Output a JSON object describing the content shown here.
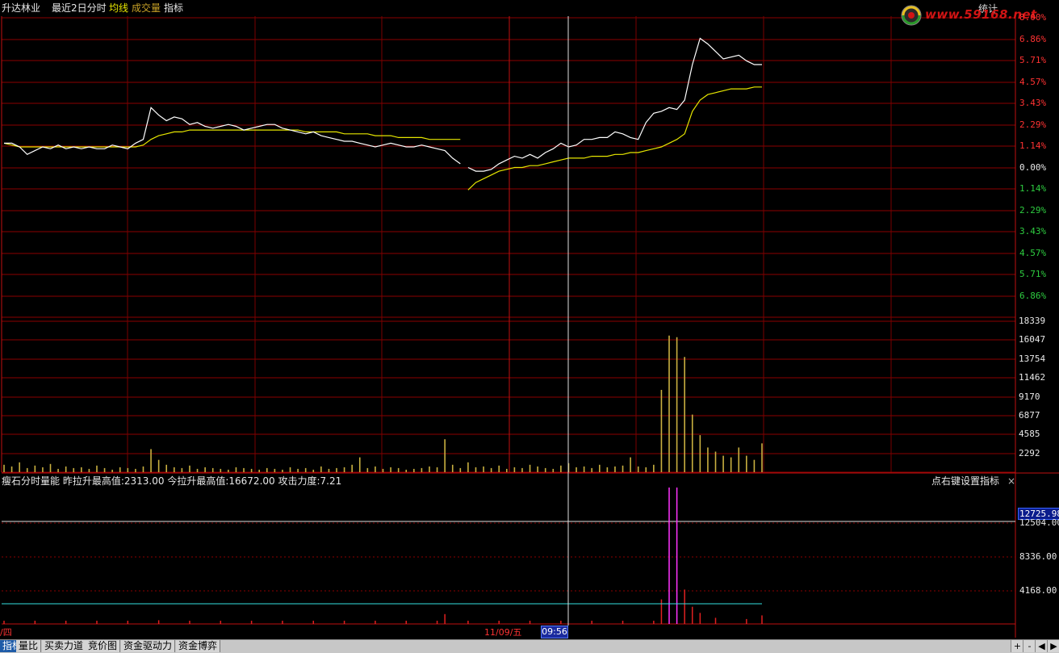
{
  "header": {
    "stock_name": "升达林业",
    "period": "最近2日分时",
    "avg_line_label": "均线",
    "volume_label": "成交量",
    "indicator_label": "指标",
    "stats_button": "统计",
    "watermark": "www.59168.net"
  },
  "price_axis": {
    "up_labels": [
      "8.00%",
      "6.86%",
      "5.71%",
      "4.57%",
      "3.43%",
      "2.29%",
      "1.14%"
    ],
    "zero_label": "0.00%",
    "down_labels": [
      "1.14%",
      "2.29%",
      "3.43%",
      "4.57%",
      "5.71%",
      "6.86%"
    ]
  },
  "volume_axis": [
    "18339",
    "16047",
    "13754",
    "11462",
    "9170",
    "6877",
    "4585",
    "2292"
  ],
  "indicator": {
    "title": "瘦石分时量能",
    "yesterday_label": "昨拉升最高值:",
    "yesterday_value": "2313.00",
    "today_label": "今拉升最高值:",
    "today_value": "16672.00",
    "attack_label": "攻击力度:",
    "attack_value": "7.21",
    "hint": "点右键设置指标",
    "close_symbol": "×",
    "levels": [
      "12725.98",
      "12504.00",
      "8336.00",
      "4168.00"
    ]
  },
  "time_axis": {
    "day1_label": "/四",
    "day2_label": "11/09/五",
    "cursor_time": "09:56"
  },
  "tabs": [
    "指标",
    "量比",
    "买卖力道",
    "竞价图",
    "资金驱动力",
    "资金博弈"
  ],
  "tab_buttons": [
    "+",
    "-",
    "◀",
    "▶"
  ],
  "colors": {
    "grid": "#8c0000",
    "price": "#ffffff",
    "avg": "#e6e600",
    "volume": "#c9b040",
    "magenta": "#ff33ff",
    "cyan": "#33e0e0"
  },
  "chart_data": {
    "type": "line",
    "title": "",
    "ylim": [
      -8.0,
      8.0
    ],
    "yticks_pct": [
      8.0,
      6.86,
      5.71,
      4.57,
      3.43,
      2.29,
      1.14,
      0,
      -1.14,
      -2.29,
      -3.43,
      -4.57,
      -5.71,
      -6.86
    ],
    "series": [
      {
        "name": "",
        "values_pct": [
          1.3,
          1.3,
          1.1,
          0.7,
          0.9,
          1.1,
          1.0,
          1.2,
          1.0,
          1.1,
          1.0,
          1.1,
          1.0,
          1.0,
          1.2,
          1.1,
          1.0,
          1.3,
          1.5,
          3.2,
          2.8,
          2.5,
          2.7,
          2.6,
          2.3,
          2.4,
          2.2,
          2.1,
          2.2,
          2.3,
          2.2,
          2.0,
          2.1,
          2.2,
          2.3,
          2.3,
          2.1,
          2.0,
          1.9,
          1.8,
          1.9,
          1.7,
          1.6,
          1.5,
          1.4,
          1.4,
          1.3,
          1.2,
          1.1,
          1.2,
          1.3,
          1.2,
          1.1,
          1.1,
          1.2,
          1.1,
          1.0,
          0.9,
          0.5,
          0.2,
          0.0,
          -0.2,
          -0.2,
          -0.1,
          0.2,
          0.4,
          0.6,
          0.5,
          0.7,
          0.5,
          0.8,
          1.0,
          1.3,
          1.1,
          1.2,
          1.5,
          1.5,
          1.6,
          1.6,
          1.9,
          1.8,
          1.6,
          1.5,
          2.4,
          2.9,
          3.0,
          3.2,
          3.1,
          3.6,
          5.5,
          6.9,
          6.6,
          6.2,
          5.8,
          5.9,
          6.0,
          5.7,
          5.5,
          5.5
        ]
      },
      {
        "name": "均线",
        "values_pct": [
          1.3,
          1.2,
          1.1,
          1.1,
          1.1,
          1.1,
          1.1,
          1.1,
          1.1,
          1.1,
          1.1,
          1.1,
          1.1,
          1.1,
          1.1,
          1.1,
          1.1,
          1.1,
          1.2,
          1.5,
          1.7,
          1.8,
          1.9,
          1.9,
          2.0,
          2.0,
          2.0,
          2.0,
          2.0,
          2.0,
          2.0,
          2.0,
          2.0,
          2.0,
          2.0,
          2.0,
          2.0,
          2.0,
          2.0,
          1.9,
          1.9,
          1.9,
          1.9,
          1.9,
          1.8,
          1.8,
          1.8,
          1.8,
          1.7,
          1.7,
          1.7,
          1.6,
          1.6,
          1.6,
          1.6,
          1.5,
          1.5,
          1.5,
          1.5,
          1.5,
          -1.2,
          -0.8,
          -0.6,
          -0.4,
          -0.2,
          -0.1,
          0.0,
          0.0,
          0.1,
          0.1,
          0.2,
          0.3,
          0.4,
          0.5,
          0.5,
          0.5,
          0.6,
          0.6,
          0.6,
          0.7,
          0.7,
          0.8,
          0.8,
          0.9,
          1.0,
          1.1,
          1.3,
          1.5,
          1.8,
          3.0,
          3.6,
          3.9,
          4.0,
          4.1,
          4.2,
          4.2,
          4.2,
          4.3,
          4.3
        ]
      }
    ],
    "volume_values": [
      900,
      700,
      1200,
      500,
      800,
      600,
      1000,
      400,
      700,
      500,
      600,
      400,
      800,
      500,
      300,
      600,
      500,
      400,
      700,
      2800,
      1500,
      900,
      600,
      500,
      800,
      400,
      600,
      500,
      400,
      300,
      600,
      500,
      400,
      300,
      500,
      400,
      300,
      600,
      400,
      500,
      300,
      700,
      400,
      500,
      600,
      900,
      1800,
      500,
      700,
      400,
      600,
      500,
      300,
      400,
      500,
      700,
      600,
      4000,
      900,
      500,
      1200,
      600,
      700,
      500,
      800,
      400,
      600,
      500,
      900,
      700,
      500,
      400,
      800,
      1100,
      600,
      700,
      500,
      900,
      600,
      700,
      800,
      1800,
      700,
      600,
      900,
      10000,
      16600,
      16400,
      14000,
      7000,
      4500,
      3000,
      2500,
      2000,
      1800,
      3000,
      2000,
      1500,
      3500
    ]
  }
}
